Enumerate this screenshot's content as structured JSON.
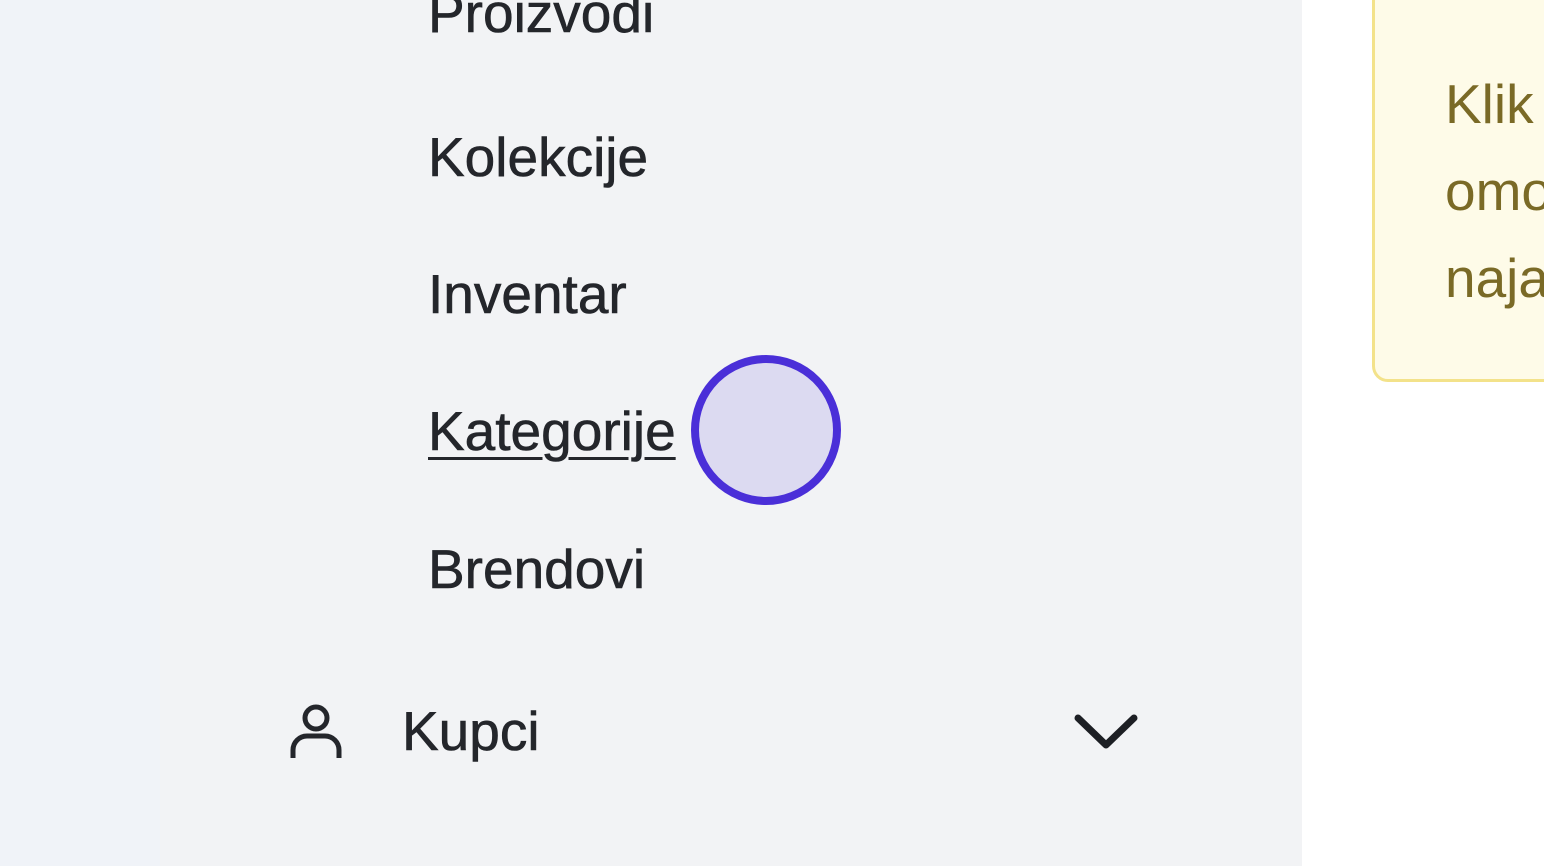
{
  "sidebar": {
    "sub_items": [
      {
        "label": "Proizvodi"
      },
      {
        "label": "Kolekcije"
      },
      {
        "label": "Inventar"
      },
      {
        "label": "Kategorije",
        "active": true
      },
      {
        "label": "Brendovi"
      }
    ],
    "group": {
      "label": "Kupci",
      "icon": "user-icon",
      "expand_icon": "chevron-down-icon"
    }
  },
  "notice": {
    "lines": [
      "Klik",
      "omo",
      "naja"
    ]
  },
  "colors": {
    "accent": "#4a2fd8",
    "text": "#24262b",
    "notice_background": "#fefbe8",
    "notice_border": "#f3e28a",
    "notice_text": "#7a6a26"
  }
}
